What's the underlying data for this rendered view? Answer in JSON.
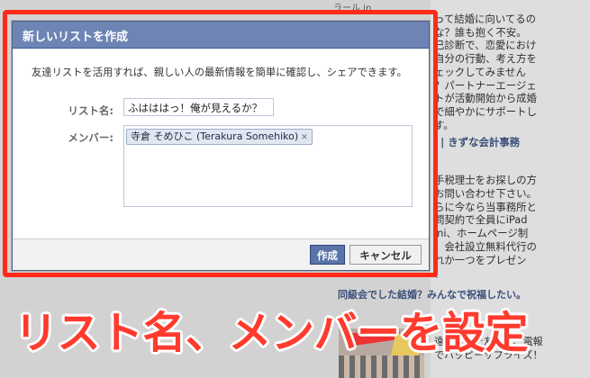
{
  "background": {
    "top_text": "ラール.in",
    "right_text_1": "って結婚に向いてるの\nな？誰も抱く不安。\n己診断で、恋愛におけ\n自分の行動、考え方を\nェックしてみません\n？パートナーエージェ\nトが活動開始から成婚\nで細やかにサポートし\nす。",
    "link_text": "! | きずな会計事務",
    "right_text_2": "手税理士をお探しの方\nお問い合わせ下さい。\nらに今なら当事務所と\n問契約で全員にiPad\nini、ホームページ制\n、会社設立無料代行の\nれか一つをプレゼン\n！",
    "headline": "同級会でした結婚？みんなで祝福したい。",
    "right_text_3": "遠く離れた友人に、電報\nでハッピーサプライズ！"
  },
  "dialog": {
    "title": "新しいリストを作成",
    "description": "友達リストを活用すれば、親しい人の最新情報を簡単に確認し、シェアできます。",
    "name_label": "リスト名:",
    "name_value": "ふはははっ！俺が見えるか？",
    "members_label": "メンバー:",
    "members": [
      {
        "name": "寺倉 そめひこ (Terakura Somehiko)"
      }
    ],
    "create_button": "作成",
    "cancel_button": "キャンセル"
  },
  "annotation": {
    "caption": "リスト名、メンバーを設定",
    "color": "#ff2a1a"
  }
}
